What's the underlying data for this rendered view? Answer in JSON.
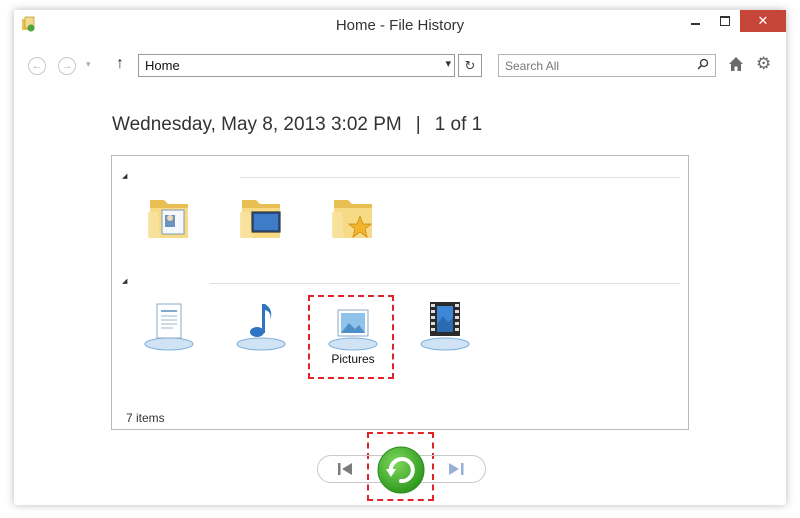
{
  "window": {
    "title": "Home - File History",
    "close_glyph": "✕"
  },
  "toolbar": {
    "back_glyph": "←",
    "forward_glyph": "→",
    "dropdown_glyph": "▾",
    "up_glyph": "↑",
    "address_value": "Home",
    "address_dropdown_glyph": "▾",
    "refresh_glyph": "↻",
    "search_placeholder": "Search All",
    "gear_glyph": "⚙"
  },
  "heading": {
    "date": "Wednesday, May 8, 2013 3:02 PM",
    "separator": "|",
    "position": "1 of 1"
  },
  "groups": [
    {
      "collapse_glyph": "◢",
      "items": [
        {
          "icon": "contacts-folder-icon",
          "label": ""
        },
        {
          "icon": "desktop-folder-icon",
          "label": ""
        },
        {
          "icon": "favorites-folder-icon",
          "label": ""
        }
      ]
    },
    {
      "collapse_glyph": "◢",
      "items": [
        {
          "icon": "documents-library-icon",
          "label": ""
        },
        {
          "icon": "music-library-icon",
          "label": ""
        },
        {
          "icon": "pictures-library-icon",
          "label": "Pictures"
        },
        {
          "icon": "videos-library-icon",
          "label": ""
        }
      ]
    }
  ],
  "status": {
    "item_count": "7 items"
  },
  "colors": {
    "highlight": "#e0242a",
    "restore_green": "#3fae2a",
    "close_red": "#c7463a",
    "folder_yellow": "#f2cf6b"
  }
}
